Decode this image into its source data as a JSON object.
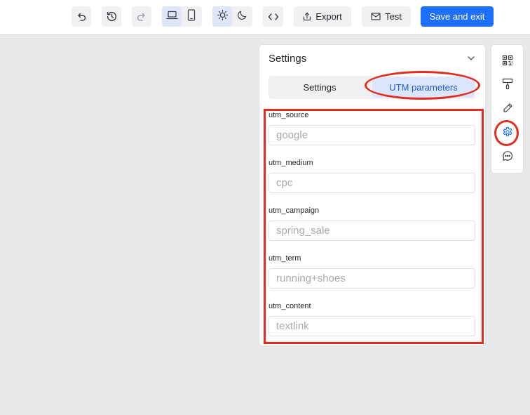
{
  "toolbar": {
    "undo_icon": "undo-icon",
    "history_icon": "history-icon",
    "redo_icon": "redo-icon",
    "desktop_icon": "laptop-icon",
    "mobile_icon": "mobile-icon",
    "light_icon": "sun-icon",
    "dark_icon": "moon-icon",
    "code_icon": "code-icon",
    "export_label": "Export",
    "test_label": "Test",
    "save_label": "Save and exit",
    "accent_color": "#1f6fff"
  },
  "panel": {
    "title": "Settings",
    "tabs": [
      {
        "label": "Settings",
        "active": false
      },
      {
        "label": "UTM parameters",
        "active": true
      }
    ],
    "fields": [
      {
        "label": "utm_source",
        "value": "",
        "placeholder": "google"
      },
      {
        "label": "utm_medium",
        "value": "",
        "placeholder": "cpc"
      },
      {
        "label": "utm_campaign",
        "value": "",
        "placeholder": "spring_sale"
      },
      {
        "label": "utm_term",
        "value": "",
        "placeholder": "running+shoes"
      },
      {
        "label": "utm_content",
        "value": "",
        "placeholder": "textlink"
      }
    ]
  },
  "rail": {
    "items": [
      "qr-code-icon",
      "paint-roller-icon",
      "pencil-icon",
      "gear-icon",
      "chat-icon"
    ],
    "active": "gear-icon"
  },
  "annotation_color": "#e12d1f"
}
